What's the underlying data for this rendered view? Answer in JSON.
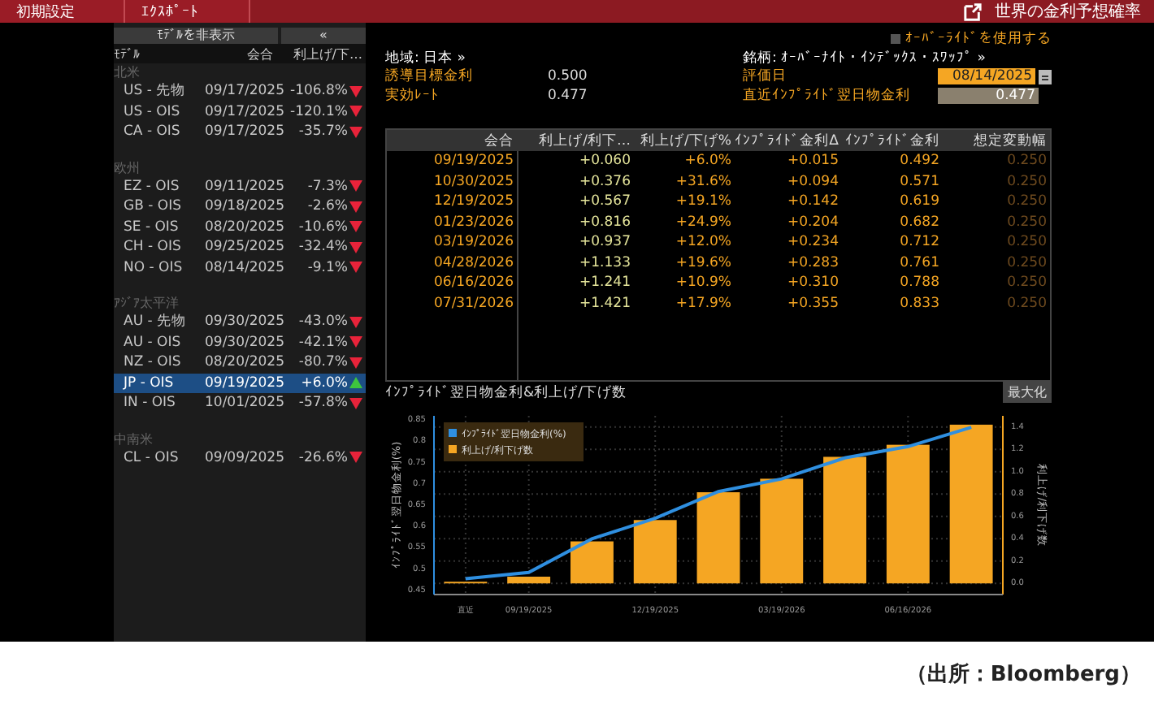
{
  "top_bar": {
    "buttons": [
      "初期設定",
      "ｴｸｽﾎﾟｰﾄ"
    ],
    "title": "世界の金利予想確率"
  },
  "model_panel": {
    "hide_button": "ﾓﾃﾞﾙを非表示",
    "collapse_button": "«",
    "columns": [
      "ﾓﾃﾞﾙ",
      "会合",
      "利上げ/下…"
    ],
    "groups": [
      {
        "name": "北米",
        "rows": [
          {
            "model": "US - 先物",
            "date": "09/17/2025",
            "change": "-106.8%",
            "rising": false,
            "selected": false
          },
          {
            "model": "US - OIS",
            "date": "09/17/2025",
            "change": "-120.1%",
            "rising": false,
            "selected": false
          },
          {
            "model": "CA - OIS",
            "date": "09/17/2025",
            "change": "-35.7%",
            "rising": false,
            "selected": false
          }
        ]
      },
      {
        "name": "欧州",
        "rows": [
          {
            "model": "EZ - OIS",
            "date": "09/11/2025",
            "change": "-7.3%",
            "rising": false,
            "selected": false
          },
          {
            "model": "GB - OIS",
            "date": "09/18/2025",
            "change": "-2.6%",
            "rising": false,
            "selected": false
          },
          {
            "model": "SE - OIS",
            "date": "08/20/2025",
            "change": "-10.6%",
            "rising": false,
            "selected": false
          },
          {
            "model": "CH - OIS",
            "date": "09/25/2025",
            "change": "-32.4%",
            "rising": false,
            "selected": false
          },
          {
            "model": "NO - OIS",
            "date": "08/14/2025",
            "change": "-9.1%",
            "rising": false,
            "selected": false
          }
        ]
      },
      {
        "name": "ｱｼﾞｱ太平洋",
        "rows": [
          {
            "model": "AU - 先物",
            "date": "09/30/2025",
            "change": "-43.0%",
            "rising": false,
            "selected": false
          },
          {
            "model": "AU - OIS",
            "date": "09/30/2025",
            "change": "-42.1%",
            "rising": false,
            "selected": false
          },
          {
            "model": "NZ - OIS",
            "date": "08/20/2025",
            "change": "-80.7%",
            "rising": false,
            "selected": false
          },
          {
            "model": "JP - OIS",
            "date": "09/19/2025",
            "change": "+6.0%",
            "rising": true,
            "selected": true
          },
          {
            "model": "IN - OIS",
            "date": "10/01/2025",
            "change": "-57.8%",
            "rising": false,
            "selected": false
          }
        ]
      },
      {
        "name": "中南米",
        "rows": [
          {
            "model": "CL - OIS",
            "date": "09/09/2025",
            "change": "-26.6%",
            "rising": false,
            "selected": false
          }
        ]
      }
    ]
  },
  "override": {
    "label": "ｵｰﾊﾞｰﾗｲﾄﾞを使用する",
    "checked": false
  },
  "region": "地域: 日本 »",
  "instrument": "銘柄: ｵｰﾊﾞｰﾅｲﾄ・ｲﾝﾃﾞｯｸｽ・ｽﾜｯﾌﾟ »",
  "fields_left": [
    {
      "label": "誘導目標金利",
      "value": "0.500"
    },
    {
      "label": "実効ﾚｰﾄ",
      "value": "0.477"
    }
  ],
  "valuation_date": {
    "label": "評価日",
    "value": "08/14/2025"
  },
  "recent_rate": {
    "label": "直近ｲﾝﾌﾟﾗｲﾄﾞ翌日物金利",
    "value": "0.477"
  },
  "table": {
    "columns": [
      "会合",
      "利上げ/利下…",
      "利上げ/下げ%",
      "ｲﾝﾌﾟﾗｲﾄﾞ金利Δ",
      "ｲﾝﾌﾟﾗｲﾄﾞ金利",
      "想定変動幅"
    ],
    "rows": [
      [
        "09/19/2025",
        "+0.060",
        "+6.0%",
        "+0.015",
        "0.492",
        "0.250"
      ],
      [
        "10/30/2025",
        "+0.376",
        "+31.6%",
        "+0.094",
        "0.571",
        "0.250"
      ],
      [
        "12/19/2025",
        "+0.567",
        "+19.1%",
        "+0.142",
        "0.619",
        "0.250"
      ],
      [
        "01/23/2026",
        "+0.816",
        "+24.9%",
        "+0.204",
        "0.682",
        "0.250"
      ],
      [
        "03/19/2026",
        "+0.937",
        "+12.0%",
        "+0.234",
        "0.712",
        "0.250"
      ],
      [
        "04/28/2026",
        "+1.133",
        "+19.6%",
        "+0.283",
        "0.761",
        "0.250"
      ],
      [
        "06/16/2026",
        "+1.241",
        "+10.9%",
        "+0.310",
        "0.788",
        "0.250"
      ],
      [
        "07/31/2026",
        "+1.421",
        "+17.9%",
        "+0.355",
        "0.833",
        "0.250"
      ]
    ]
  },
  "chart": {
    "title": "ｲﾝﾌﾟﾗｲﾄﾞ翌日物金利&利上げ/下げ数",
    "maximize_button": "最大化",
    "bar_layer": {
      "chart_data": {
        "type": "bar",
        "ylabel": "利上げ/利下げ数",
        "grid": true,
        "categories": [
          "直近",
          "09/19/2025",
          null,
          "12/19/2025",
          null,
          "03/19/2026",
          null,
          "06/16/2026",
          null
        ],
        "ylim": [
          -0.1,
          1.5
        ],
        "yticks": [
          {
            "value": 0,
            "label": "0.0"
          },
          {
            "value": 0.2,
            "label": "0.2"
          },
          {
            "value": 0.4,
            "label": "0.4"
          },
          {
            "value": 0.6,
            "label": "0.6"
          },
          {
            "value": 0.8,
            "label": "0.8"
          },
          {
            "value": 1.0,
            "label": "1.0"
          },
          {
            "value": 1.2,
            "label": "1.2"
          },
          {
            "value": 1.4,
            "label": "1.4"
          }
        ],
        "series": [
          {
            "name": "利上げ/利下げ数",
            "color": "#f5a623",
            "values": [
              0,
              0.06,
              0.376,
              0.567,
              0.816,
              0.937,
              1.133,
              1.241,
              1.421
            ]
          }
        ]
      }
    },
    "line_layer": {
      "chart_data": {
        "type": "line",
        "ylabel": "ｲﾝﾌﾟﾗｲﾄﾞ翌日物金利(%)",
        "ylim": [
          0.44,
          0.86
        ],
        "yticks": [
          {
            "value": 0.45,
            "label": "0.45"
          },
          {
            "value": 0.5,
            "label": "0.5"
          },
          {
            "value": 0.55,
            "label": "0.55"
          },
          {
            "value": 0.6,
            "label": "0.6"
          },
          {
            "value": 0.65,
            "label": "0.65"
          },
          {
            "value": 0.7,
            "label": "0.7"
          },
          {
            "value": 0.75,
            "label": "0.75"
          },
          {
            "value": 0.8,
            "label": "0.8"
          },
          {
            "value": 0.85,
            "label": "0.85"
          }
        ],
        "series": [
          {
            "name": "ｲﾝﾌﾟﾗｲﾄﾞ翌日物金利(%)",
            "color": "#2f8fe0",
            "values": [
              0.477,
              0.492,
              0.571,
              0.619,
              0.682,
              0.712,
              0.761,
              0.788,
              0.833
            ]
          }
        ]
      }
    }
  },
  "source": "（出所：Bloomberg）"
}
